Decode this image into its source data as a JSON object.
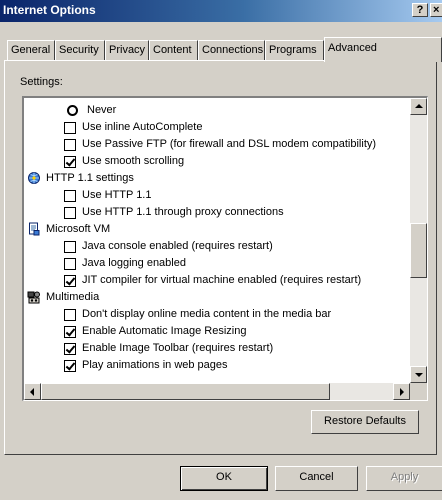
{
  "window": {
    "title": "Internet Options",
    "help_label": "?",
    "close_label": "×"
  },
  "tabs": [
    {
      "label": "General",
      "active": false
    },
    {
      "label": "Security",
      "active": false
    },
    {
      "label": "Privacy",
      "active": false
    },
    {
      "label": "Content",
      "active": false
    },
    {
      "label": "Connections",
      "active": false
    },
    {
      "label": "Programs",
      "active": false
    },
    {
      "label": "Advanced",
      "active": true
    }
  ],
  "settings_label": "Settings:",
  "settings": [
    {
      "type": "radio",
      "label": "Never",
      "checked": false,
      "level": 2
    },
    {
      "type": "checkbox",
      "label": "Use inline AutoComplete",
      "checked": false,
      "level": 1
    },
    {
      "type": "checkbox",
      "label": "Use Passive FTP (for firewall and DSL modem compatibility)",
      "checked": false,
      "level": 1
    },
    {
      "type": "checkbox",
      "label": "Use smooth scrolling",
      "checked": true,
      "level": 1
    },
    {
      "type": "group",
      "label": "HTTP 1.1 settings",
      "icon": "globe-settings-icon",
      "level": 0
    },
    {
      "type": "checkbox",
      "label": "Use HTTP 1.1",
      "checked": false,
      "level": 1
    },
    {
      "type": "checkbox",
      "label": "Use HTTP 1.1 through proxy connections",
      "checked": false,
      "level": 1
    },
    {
      "type": "group",
      "label": "Microsoft VM",
      "icon": "document-settings-icon",
      "level": 0
    },
    {
      "type": "checkbox",
      "label": "Java console enabled (requires restart)",
      "checked": false,
      "level": 1
    },
    {
      "type": "checkbox",
      "label": "Java logging enabled",
      "checked": false,
      "level": 1
    },
    {
      "type": "checkbox",
      "label": "JIT compiler for virtual machine enabled (requires restart)",
      "checked": true,
      "level": 1
    },
    {
      "type": "group",
      "label": "Multimedia",
      "icon": "multimedia-icon",
      "level": 0
    },
    {
      "type": "checkbox",
      "label": "Don't display online media content in the media bar",
      "checked": false,
      "level": 1
    },
    {
      "type": "checkbox",
      "label": "Enable Automatic Image Resizing",
      "checked": true,
      "level": 1
    },
    {
      "type": "checkbox",
      "label": "Enable Image Toolbar (requires restart)",
      "checked": true,
      "level": 1
    },
    {
      "type": "checkbox",
      "label": "Play animations in web pages",
      "checked": true,
      "level": 1
    }
  ],
  "scroll": {
    "vertical_position": 0.55,
    "vertical_thumb_size": 0.22,
    "horizontal_position": 0.0,
    "horizontal_thumb_size": 0.82
  },
  "buttons": {
    "restore_defaults": "Restore Defaults",
    "ok": "OK",
    "cancel": "Cancel",
    "apply": "Apply"
  },
  "colors": {
    "face": "#d4d0c8",
    "title_start": "#0a246a",
    "title_end": "#a6caf0",
    "disabled_text": "#808080"
  }
}
